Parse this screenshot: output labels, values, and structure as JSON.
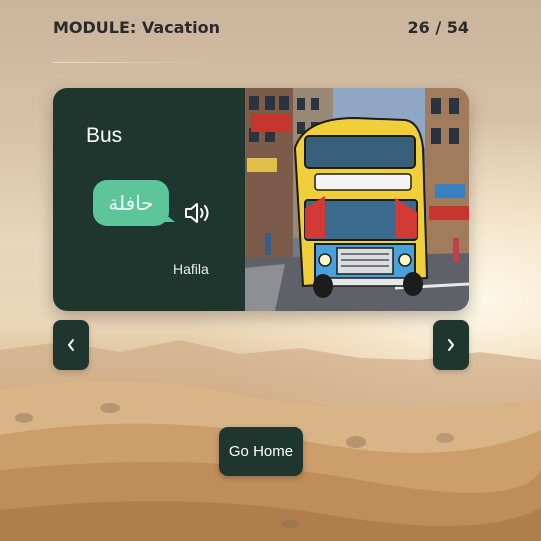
{
  "header": {
    "module_label": "MODULE: Vacation",
    "progress": "26 / 54"
  },
  "flashcard": {
    "english_word": "Bus",
    "arabic_word": "حافلة",
    "transliteration": "Hafila",
    "audio_icon": "speaker-icon",
    "image_subject": "double-decker bus on city street"
  },
  "navigation": {
    "prev_icon": "chevron-left-icon",
    "next_icon": "chevron-right-icon"
  },
  "actions": {
    "home_label": "Go Home"
  },
  "colors": {
    "card_dark": "#1f362f",
    "bubble_green": "#5ec49a"
  }
}
